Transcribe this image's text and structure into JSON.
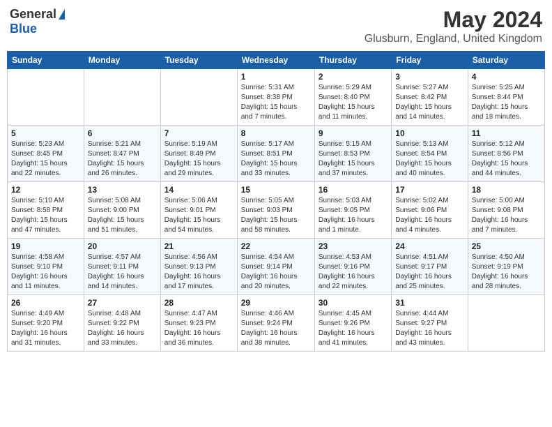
{
  "header": {
    "logo_general": "General",
    "logo_blue": "Blue",
    "title": "May 2024",
    "subtitle": "Glusburn, England, United Kingdom"
  },
  "days_of_week": [
    "Sunday",
    "Monday",
    "Tuesday",
    "Wednesday",
    "Thursday",
    "Friday",
    "Saturday"
  ],
  "weeks": [
    [
      {
        "day": "",
        "info": ""
      },
      {
        "day": "",
        "info": ""
      },
      {
        "day": "",
        "info": ""
      },
      {
        "day": "1",
        "info": "Sunrise: 5:31 AM\nSunset: 8:38 PM\nDaylight: 15 hours\nand 7 minutes."
      },
      {
        "day": "2",
        "info": "Sunrise: 5:29 AM\nSunset: 8:40 PM\nDaylight: 15 hours\nand 11 minutes."
      },
      {
        "day": "3",
        "info": "Sunrise: 5:27 AM\nSunset: 8:42 PM\nDaylight: 15 hours\nand 14 minutes."
      },
      {
        "day": "4",
        "info": "Sunrise: 5:25 AM\nSunset: 8:44 PM\nDaylight: 15 hours\nand 18 minutes."
      }
    ],
    [
      {
        "day": "5",
        "info": "Sunrise: 5:23 AM\nSunset: 8:45 PM\nDaylight: 15 hours\nand 22 minutes."
      },
      {
        "day": "6",
        "info": "Sunrise: 5:21 AM\nSunset: 8:47 PM\nDaylight: 15 hours\nand 26 minutes."
      },
      {
        "day": "7",
        "info": "Sunrise: 5:19 AM\nSunset: 8:49 PM\nDaylight: 15 hours\nand 29 minutes."
      },
      {
        "day": "8",
        "info": "Sunrise: 5:17 AM\nSunset: 8:51 PM\nDaylight: 15 hours\nand 33 minutes."
      },
      {
        "day": "9",
        "info": "Sunrise: 5:15 AM\nSunset: 8:53 PM\nDaylight: 15 hours\nand 37 minutes."
      },
      {
        "day": "10",
        "info": "Sunrise: 5:13 AM\nSunset: 8:54 PM\nDaylight: 15 hours\nand 40 minutes."
      },
      {
        "day": "11",
        "info": "Sunrise: 5:12 AM\nSunset: 8:56 PM\nDaylight: 15 hours\nand 44 minutes."
      }
    ],
    [
      {
        "day": "12",
        "info": "Sunrise: 5:10 AM\nSunset: 8:58 PM\nDaylight: 15 hours\nand 47 minutes."
      },
      {
        "day": "13",
        "info": "Sunrise: 5:08 AM\nSunset: 9:00 PM\nDaylight: 15 hours\nand 51 minutes."
      },
      {
        "day": "14",
        "info": "Sunrise: 5:06 AM\nSunset: 9:01 PM\nDaylight: 15 hours\nand 54 minutes."
      },
      {
        "day": "15",
        "info": "Sunrise: 5:05 AM\nSunset: 9:03 PM\nDaylight: 15 hours\nand 58 minutes."
      },
      {
        "day": "16",
        "info": "Sunrise: 5:03 AM\nSunset: 9:05 PM\nDaylight: 16 hours\nand 1 minute."
      },
      {
        "day": "17",
        "info": "Sunrise: 5:02 AM\nSunset: 9:06 PM\nDaylight: 16 hours\nand 4 minutes."
      },
      {
        "day": "18",
        "info": "Sunrise: 5:00 AM\nSunset: 9:08 PM\nDaylight: 16 hours\nand 7 minutes."
      }
    ],
    [
      {
        "day": "19",
        "info": "Sunrise: 4:58 AM\nSunset: 9:10 PM\nDaylight: 16 hours\nand 11 minutes."
      },
      {
        "day": "20",
        "info": "Sunrise: 4:57 AM\nSunset: 9:11 PM\nDaylight: 16 hours\nand 14 minutes."
      },
      {
        "day": "21",
        "info": "Sunrise: 4:56 AM\nSunset: 9:13 PM\nDaylight: 16 hours\nand 17 minutes."
      },
      {
        "day": "22",
        "info": "Sunrise: 4:54 AM\nSunset: 9:14 PM\nDaylight: 16 hours\nand 20 minutes."
      },
      {
        "day": "23",
        "info": "Sunrise: 4:53 AM\nSunset: 9:16 PM\nDaylight: 16 hours\nand 22 minutes."
      },
      {
        "day": "24",
        "info": "Sunrise: 4:51 AM\nSunset: 9:17 PM\nDaylight: 16 hours\nand 25 minutes."
      },
      {
        "day": "25",
        "info": "Sunrise: 4:50 AM\nSunset: 9:19 PM\nDaylight: 16 hours\nand 28 minutes."
      }
    ],
    [
      {
        "day": "26",
        "info": "Sunrise: 4:49 AM\nSunset: 9:20 PM\nDaylight: 16 hours\nand 31 minutes."
      },
      {
        "day": "27",
        "info": "Sunrise: 4:48 AM\nSunset: 9:22 PM\nDaylight: 16 hours\nand 33 minutes."
      },
      {
        "day": "28",
        "info": "Sunrise: 4:47 AM\nSunset: 9:23 PM\nDaylight: 16 hours\nand 36 minutes."
      },
      {
        "day": "29",
        "info": "Sunrise: 4:46 AM\nSunset: 9:24 PM\nDaylight: 16 hours\nand 38 minutes."
      },
      {
        "day": "30",
        "info": "Sunrise: 4:45 AM\nSunset: 9:26 PM\nDaylight: 16 hours\nand 41 minutes."
      },
      {
        "day": "31",
        "info": "Sunrise: 4:44 AM\nSunset: 9:27 PM\nDaylight: 16 hours\nand 43 minutes."
      },
      {
        "day": "",
        "info": ""
      }
    ]
  ]
}
